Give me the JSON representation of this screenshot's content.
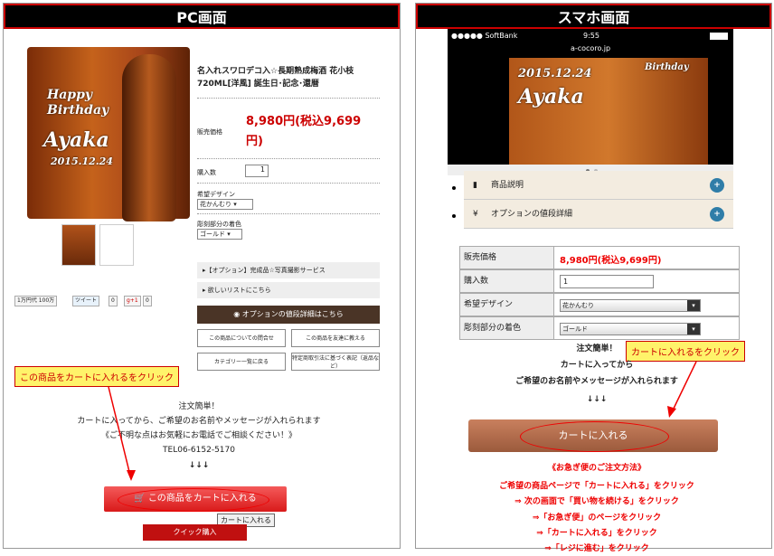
{
  "pc": {
    "header": "PC画面",
    "bottle_text": [
      "Happy",
      "Birthday",
      "Ayaka",
      "2015.12.24"
    ],
    "title": "名入れスワロデコ入☆長期熟成梅酒 花小枝720ML[洋風] 誕生日･記念･還暦",
    "price_label": "販売価格",
    "price": "8,980円(税込9,699円)",
    "qty_label": "購入数",
    "qty_value": "1",
    "design_label": "希望デザイン",
    "design_value": "花かんむり",
    "color_label": "彫刻部分の着色",
    "color_value": "ゴールド",
    "option_link": "▸【オプション】完成品☆写真撮影サービス",
    "wishlist_link": "▸ 欲しいリストにこちら",
    "option_detail_button": "◉ オプションの値段詳細はこちら",
    "small_buttons": [
      "この商品についての問合せ",
      "この商品を友達に教える",
      "カテゴリー一覧に戻る",
      "特定商取引法に基づく表記（返品など）"
    ],
    "social": {
      "like": "1万円代 100万",
      "tweet": "ツイート",
      "tweet_count": "0",
      "gplus": "g+1",
      "gplus_count": "0"
    },
    "callout": "この商品をカートに入れるをクリック",
    "text_lines": [
      "注文簡単！",
      "カートに入ってから、ご希望のお名前やメッセージが入れられます",
      "《ご不明な点はお気軽にお電話でご相談ください！》",
      "TEL06-6152-5170",
      "↓↓↓"
    ],
    "cart_button": "この商品をカートに入れる",
    "tooltip": "カートに入れる",
    "quick_button": "クイック購入"
  },
  "sp": {
    "header": "スマホ画面",
    "carrier": "●●●●● SoftBank",
    "time": "9:55",
    "url": "a-cocoro.jp",
    "bottle_text": [
      "2015.12.24",
      "Ayaka",
      "Birthday"
    ],
    "acc_items": [
      "商品説明",
      "オプションの値段詳細"
    ],
    "price_label": "販売価格",
    "price": "8,980円(税込9,699円)",
    "qty_label": "購入数",
    "qty_value": "1",
    "design_label": "希望デザイン",
    "design_value": "花かんむり",
    "color_label": "彫刻部分の着色",
    "color_value": "ゴールド",
    "callout": "カートに入れるをクリック",
    "text_lines": [
      "注文簡単！",
      "カートに入ってから",
      "ご希望のお名前やメッセージが入れられます",
      "↓↓↓"
    ],
    "cart_button": "カートに入れる",
    "urgent_title": "《お急ぎ便のご注文方法》",
    "urgent_lines": [
      "ご希望の商品ページで「カートに入れる」をクリック",
      "⇒ 次の画面で「買い物を続ける」をクリック",
      "⇒「お急ぎ便」のページをクリック",
      "⇒「カートに入れる」をクリック",
      "⇒「レジに進む」をクリック"
    ]
  }
}
